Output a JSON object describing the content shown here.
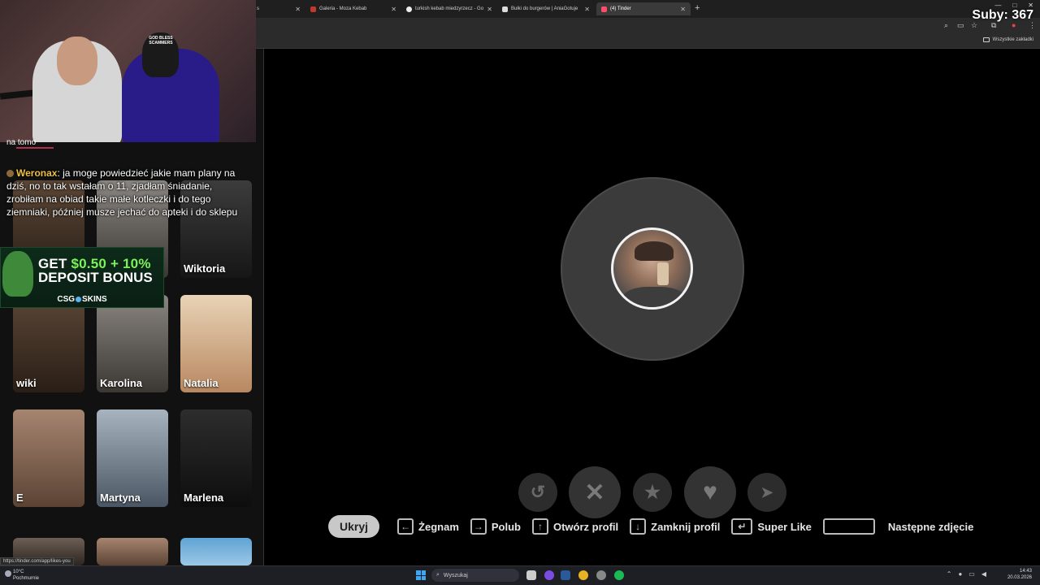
{
  "browser": {
    "tabs": [
      {
        "label": "s",
        "active": false
      },
      {
        "label": "Galeria - Moza Kebab",
        "active": false
      },
      {
        "label": "turkish kebab miedzyrzecz - Go",
        "active": false
      },
      {
        "label": "Bułki do burgerów | AniaGotuje",
        "active": false
      },
      {
        "label": "(4) Tinder",
        "active": true
      }
    ],
    "bookmarks_label": "Wszystkie zakładki"
  },
  "stream": {
    "subs": "Suby: 367",
    "chat": {
      "top_fragment": "na tomo",
      "username": "Weronax",
      "message": ": ja moge powiedzieć jakie mam plany na dziś, no to tak wstałam o 11, zjadłam śniadanie, zrobiłam na obiad takie małe kotleczki i do tego ziemniaki, później musze jechać do apteki i do sklepu"
    },
    "webcam": {
      "cap_text": "GOD BLESS SCAMMERS"
    },
    "ad": {
      "line1_prefix": "GET ",
      "line1_amount": "$0.50",
      "line1_suffix": " + 10%",
      "line2": "DEPOSIT BONUS",
      "brand_left": "CSG",
      "brand_right": "SKINS"
    }
  },
  "likes_grid": {
    "cards": [
      {
        "name": "Wiktoria"
      },
      {
        "name": "wiki"
      },
      {
        "name": "Karolina"
      },
      {
        "name": "Natalia"
      },
      {
        "name": "E"
      },
      {
        "name": "Martyna"
      },
      {
        "name": "Marlena"
      }
    ]
  },
  "actions": {
    "rewind_icon": "rewind-icon",
    "nope_icon": "close-icon",
    "superlike_icon": "star-icon",
    "like_icon": "heart-icon",
    "boost_icon": "send-icon"
  },
  "hints": {
    "hide": "Ukryj",
    "nope": "Żegnam",
    "like": "Polub",
    "open_profile": "Otwórz profil",
    "close_profile": "Zamknij profil",
    "super_like": "Super Like",
    "next_photo": "Następne zdjęcie"
  },
  "status_url": "https://tinder.com/app/likes-you",
  "taskbar": {
    "weather_temp": "10°C",
    "weather_desc": "Pochmurnie",
    "search_placeholder": "Wyszukaj",
    "time": "14:43",
    "date": "20.03.2026"
  },
  "colors": {
    "chat_username": "#f0c040",
    "ad_accent": "#7cf25a"
  }
}
